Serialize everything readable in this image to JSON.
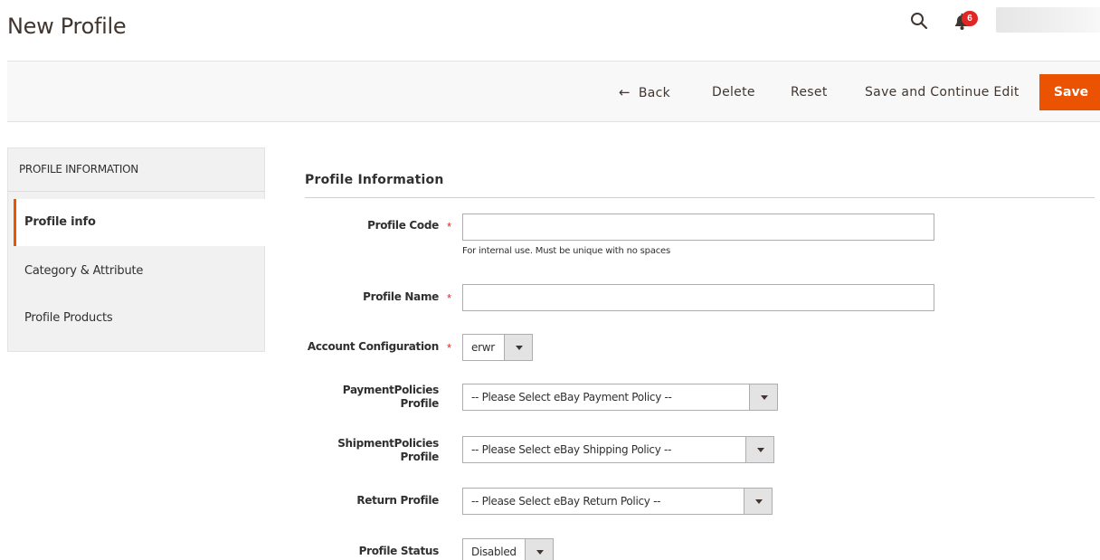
{
  "header": {
    "title": "New Profile",
    "notification_count": "6",
    "icons": {
      "search": "search-icon",
      "notifications": "bell-icon"
    }
  },
  "actions": {
    "back": "Back",
    "delete": "Delete",
    "reset": "Reset",
    "save_continue": "Save and Continue Edit",
    "save": "Save"
  },
  "sidebar": {
    "title": "PROFILE INFORMATION",
    "items": [
      {
        "label": "Profile info",
        "active": true
      },
      {
        "label": "Category & Attribute",
        "active": false
      },
      {
        "label": "Profile Products",
        "active": false
      }
    ]
  },
  "form": {
    "section_title": "Profile Information",
    "profile_code": {
      "label": "Profile Code",
      "value": "",
      "note": "For internal use. Must be unique with no spaces"
    },
    "profile_name": {
      "label": "Profile Name",
      "value": ""
    },
    "account_configuration": {
      "label": "Account Configuration",
      "value": "erwr"
    },
    "payment_policies": {
      "label_line1": "PaymentPolicies",
      "label_line2": "Profile",
      "value": "-- Please Select eBay Payment Policy --"
    },
    "shipment_policies": {
      "label_line1": "ShipmentPolicies",
      "label_line2": "Profile",
      "value": "-- Please Select eBay Shipping Policy --"
    },
    "return_profile": {
      "label": "Return Profile",
      "value": "-- Please Select eBay Return Policy --"
    },
    "profile_status": {
      "label": "Profile Status",
      "value": "Disabled"
    }
  },
  "colors": {
    "accent": "#eb5202",
    "required": "#e02b27",
    "badge": "#e22626"
  }
}
